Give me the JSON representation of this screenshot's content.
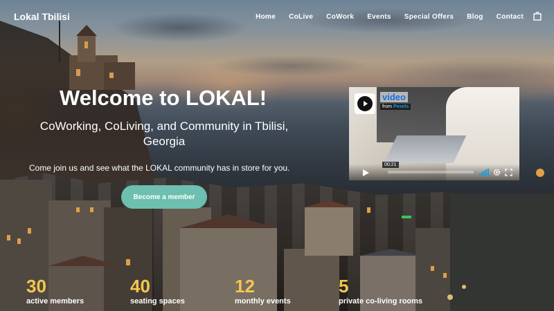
{
  "brand": "Lokal Tbilisi",
  "nav": [
    "Home",
    "CoLive",
    "CoWork",
    "Events",
    "Special Offers",
    "Blog",
    "Contact"
  ],
  "hero": {
    "title": "Welcome to LOKAL!",
    "subtitle": "CoWorking, CoLiving, and Community in Tbilisi, Georgia",
    "text": "Come join us and see what the LOKAL community has in store for you.",
    "cta": "Become a member"
  },
  "video": {
    "title": "video",
    "from_prefix": "from",
    "from_source": "Pexels",
    "time": "00:21"
  },
  "stats": [
    {
      "value": "30",
      "label": "active members"
    },
    {
      "value": "40",
      "label": "seating spaces"
    },
    {
      "value": "12",
      "label": "monthly events"
    },
    {
      "value": "5",
      "label": "private co-living rooms"
    }
  ],
  "colors": {
    "accent": "#6dbfaf",
    "stat_number": "#f2c84b",
    "video_title": "#1a6fe0"
  },
  "icons": {
    "cart": "shopping-bag-icon",
    "play": "play-icon",
    "volume": "volume-icon",
    "settings": "gear-icon",
    "fullscreen": "fullscreen-icon"
  }
}
